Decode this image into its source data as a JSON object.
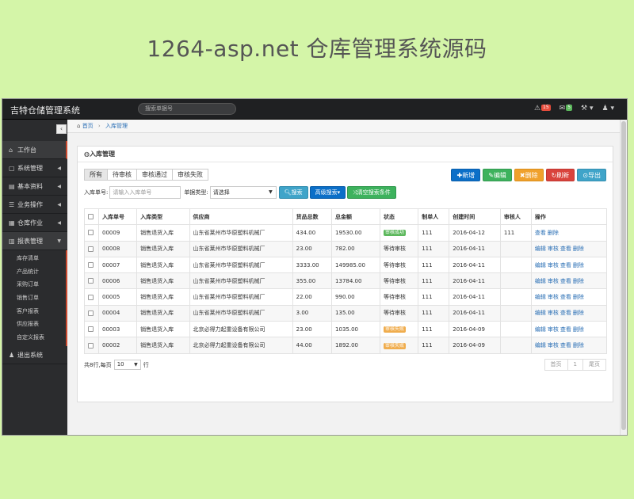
{
  "banner": "1264-asp.net 仓库管理系统源码",
  "topbar": {
    "brand": "吉特仓储管理系统",
    "search_placeholder": "搜索单据号",
    "alert_count": "15",
    "mail_count": "5"
  },
  "sidebar": {
    "collapse": "‹",
    "items": [
      {
        "icon": "⌂",
        "label": "工作台",
        "arrow": ""
      },
      {
        "icon": "▢",
        "label": "系统管理",
        "arrow": "◀"
      },
      {
        "icon": "▤",
        "label": "基本资料",
        "arrow": "◀"
      },
      {
        "icon": "☰",
        "label": "业务操作",
        "arrow": "◀"
      },
      {
        "icon": "▦",
        "label": "仓库作业",
        "arrow": "◀"
      },
      {
        "icon": "▥",
        "label": "报表管理",
        "arrow": "▼"
      },
      {
        "icon": "♟",
        "label": "退出系统",
        "arrow": ""
      }
    ],
    "report_sub": [
      "库存清单",
      "产品统计",
      "采购订单",
      "销售订单",
      "客户报表",
      "供应报表",
      "自定义报表"
    ]
  },
  "breadcrumb": {
    "home": "首页",
    "current": "入库管理"
  },
  "panel": {
    "title": "入库管理",
    "tabs": [
      "所有",
      "待审核",
      "审核通过",
      "审核失败"
    ],
    "actions": [
      "新增",
      "编辑",
      "删除",
      "刷新",
      "导出"
    ],
    "filter": {
      "order_label": "入库单号:",
      "order_placeholder": "请输入入库单号",
      "type_label": "单据类型:",
      "type_value": "请选择",
      "search": "搜索",
      "advanced": "高级搜索",
      "clear": "清空搜索条件"
    },
    "columns": [
      "入库单号",
      "入库类型",
      "供应商",
      "货品总数",
      "总金额",
      "状态",
      "制单人",
      "创建时间",
      "审核人",
      "操作"
    ],
    "rows": [
      {
        "no": "00009",
        "type": "销售退货入库",
        "supplier": "山东省莱州市华原塑料机械厂",
        "qty": "434.00",
        "amount": "19530.00",
        "status": "审核成功",
        "status_kind": "ok",
        "maker": "111",
        "date": "2016-04-12",
        "auditor": "111",
        "ops": [
          "查看",
          "删除"
        ]
      },
      {
        "no": "00008",
        "type": "销售退货入库",
        "supplier": "山东省莱州市华原塑料机械厂",
        "qty": "23.00",
        "amount": "782.00",
        "status": "等待审核",
        "status_kind": "wait",
        "maker": "111",
        "date": "2016-04-11",
        "auditor": "",
        "ops": [
          "编辑",
          "审核",
          "查看",
          "删除"
        ]
      },
      {
        "no": "00007",
        "type": "销售退货入库",
        "supplier": "山东省莱州市华原塑料机械厂",
        "qty": "3333.00",
        "amount": "149985.00",
        "status": "等待审核",
        "status_kind": "wait",
        "maker": "111",
        "date": "2016-04-11",
        "auditor": "",
        "ops": [
          "编辑",
          "审核",
          "查看",
          "删除"
        ]
      },
      {
        "no": "00006",
        "type": "销售退货入库",
        "supplier": "山东省莱州市华原塑料机械厂",
        "qty": "355.00",
        "amount": "13784.00",
        "status": "等待审核",
        "status_kind": "wait",
        "maker": "111",
        "date": "2016-04-11",
        "auditor": "",
        "ops": [
          "编辑",
          "审核",
          "查看",
          "删除"
        ]
      },
      {
        "no": "00005",
        "type": "销售退货入库",
        "supplier": "山东省莱州市华原塑料机械厂",
        "qty": "22.00",
        "amount": "990.00",
        "status": "等待审核",
        "status_kind": "wait",
        "maker": "111",
        "date": "2016-04-11",
        "auditor": "",
        "ops": [
          "编辑",
          "审核",
          "查看",
          "删除"
        ]
      },
      {
        "no": "00004",
        "type": "销售退货入库",
        "supplier": "山东省莱州市华原塑料机械厂",
        "qty": "3.00",
        "amount": "135.00",
        "status": "等待审核",
        "status_kind": "wait",
        "maker": "111",
        "date": "2016-04-11",
        "auditor": "",
        "ops": [
          "编辑",
          "审核",
          "查看",
          "删除"
        ]
      },
      {
        "no": "00003",
        "type": "销售退货入库",
        "supplier": "北京必得力起重设备有限公司",
        "qty": "23.00",
        "amount": "1035.00",
        "status": "审核失败",
        "status_kind": "fail",
        "maker": "111",
        "date": "2016-04-09",
        "auditor": "",
        "ops": [
          "编辑",
          "审核",
          "查看",
          "删除"
        ]
      },
      {
        "no": "00002",
        "type": "销售退货入库",
        "supplier": "北京必得力起重设备有限公司",
        "qty": "44.00",
        "amount": "1892.00",
        "status": "审核失败",
        "status_kind": "fail",
        "maker": "111",
        "date": "2016-04-09",
        "auditor": "",
        "ops": [
          "编辑",
          "审核",
          "查看",
          "删除"
        ]
      }
    ],
    "pager": {
      "prefix": "共8行,每页",
      "per_page": "10",
      "suffix": "行",
      "first": "首页",
      "page": "1",
      "last": "尾页"
    }
  }
}
